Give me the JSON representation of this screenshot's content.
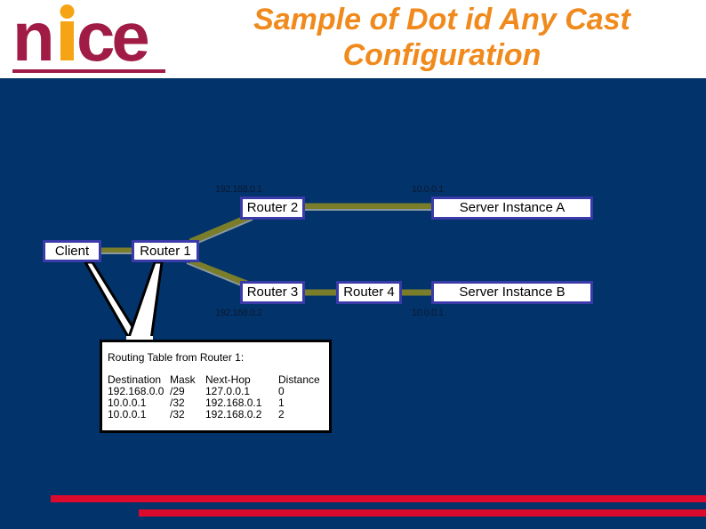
{
  "header": {
    "logo_text": "nice",
    "title": "Sample of Dot id Any Cast Configuration"
  },
  "colors": {
    "background": "#02336a",
    "title": "#f08a1c",
    "logo_primary": "#a01c46",
    "logo_accent": "#f5a414",
    "link": "#7a7d2a",
    "node_border": "#3a3aa8",
    "accent_bar": "#dc0a2c"
  },
  "nodes": {
    "client": "Client",
    "router1": "Router 1",
    "router2": "Router 2",
    "router3": "Router 3",
    "router4": "Router 4",
    "server_a": "Server Instance A",
    "server_b": "Server Instance B"
  },
  "addresses": {
    "router2_ip": "192.168.0.1",
    "server_a_ip": "10.0.0.1",
    "router3_ip": "192.168.0.2",
    "server_b_ip": "10.0.0.1"
  },
  "routing_table": {
    "title": "Routing Table from Router 1:",
    "columns": [
      "Destination",
      "Mask",
      "Next-Hop",
      "Distance"
    ],
    "rows": [
      [
        "192.168.0.0",
        "/29",
        "127.0.0.1",
        "0"
      ],
      [
        "10.0.0.1",
        "/32",
        "192.168.0.1",
        "1"
      ],
      [
        "10.0.0.1",
        "/32",
        "192.168.0.2",
        "2"
      ]
    ]
  }
}
